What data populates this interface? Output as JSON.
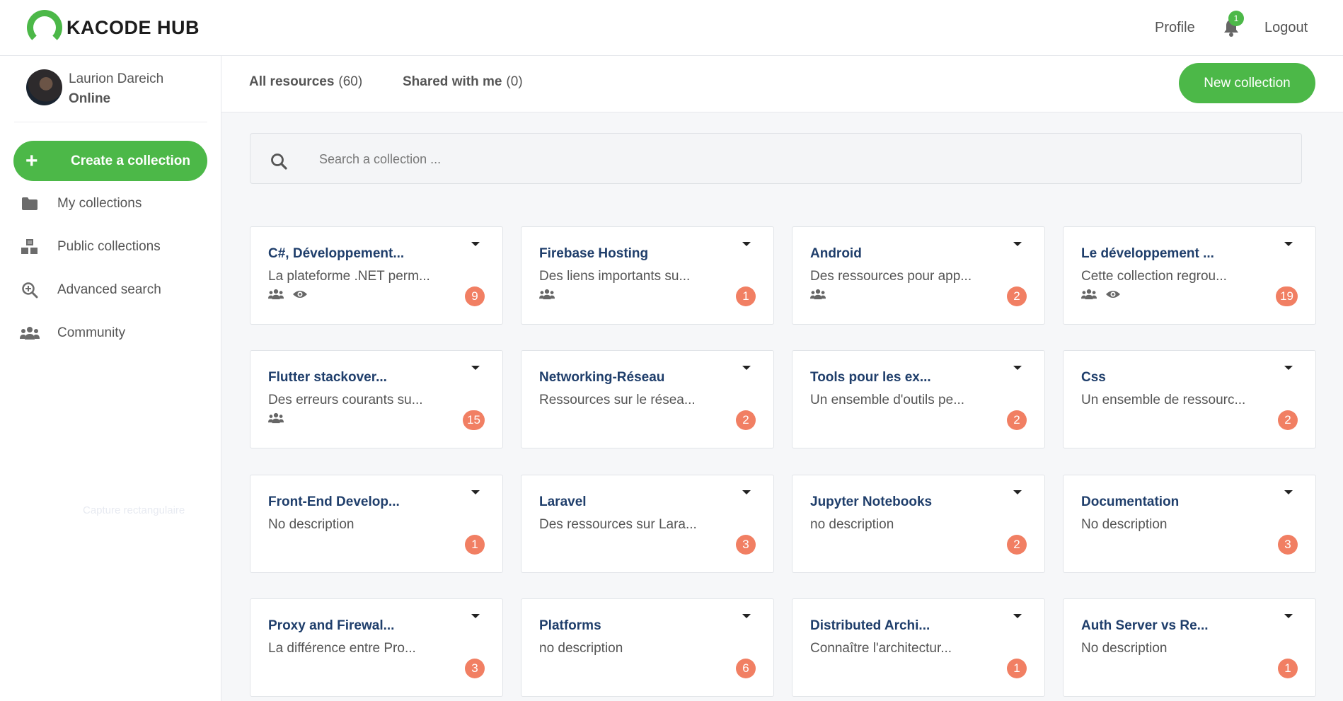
{
  "brand": {
    "logo_text": "KACODE HUB",
    "accent": "#4cb848",
    "badge_color": "#f17f63"
  },
  "topnav": {
    "profile": "Profile",
    "notifications_count": "1",
    "logout": "Logout"
  },
  "user": {
    "name": "Laurion Dareich",
    "status": "Online"
  },
  "sidebar": {
    "create_label": "Create a collection",
    "items": [
      {
        "label": "My collections",
        "icon": "folder-icon"
      },
      {
        "label": "Public collections",
        "icon": "cubes-icon"
      },
      {
        "label": "Advanced search",
        "icon": "search-plus-icon"
      },
      {
        "label": "Community",
        "icon": "users-icon"
      }
    ]
  },
  "tabs": [
    {
      "label": "All resources",
      "count": "(60)"
    },
    {
      "label": "Shared with me",
      "count": "(0)"
    }
  ],
  "new_collection_label": "New collection",
  "search": {
    "placeholder": "Search a collection ..."
  },
  "watermark": "Capture rectangulaire",
  "collections": [
    {
      "title": "C#, Développement...",
      "desc": "La plateforme .NET perm...",
      "count": "9",
      "shared": true,
      "public": true
    },
    {
      "title": "Firebase Hosting",
      "desc": "Des liens importants su...",
      "count": "1",
      "shared": true,
      "public": false
    },
    {
      "title": "Android",
      "desc": "Des ressources pour app...",
      "count": "2",
      "shared": true,
      "public": false
    },
    {
      "title": "Le développement ...",
      "desc": "Cette collection regrou...",
      "count": "19",
      "shared": true,
      "public": true
    },
    {
      "title": "Flutter stackover...",
      "desc": "Des erreurs courants su...",
      "count": "15",
      "shared": true,
      "public": false
    },
    {
      "title": "Networking-Réseau",
      "desc": "Ressources sur le résea...",
      "count": "2",
      "shared": false,
      "public": false
    },
    {
      "title": "Tools pour les ex...",
      "desc": "Un ensemble d'outils pe...",
      "count": "2",
      "shared": false,
      "public": false
    },
    {
      "title": "Css",
      "desc": "Un ensemble de ressourc...",
      "count": "2",
      "shared": false,
      "public": false
    },
    {
      "title": "Front-End Develop...",
      "desc": "No description",
      "count": "1",
      "shared": false,
      "public": false
    },
    {
      "title": "Laravel",
      "desc": "Des ressources sur Lara...",
      "count": "3",
      "shared": false,
      "public": false
    },
    {
      "title": "Jupyter Notebooks",
      "desc": "no description",
      "count": "2",
      "shared": false,
      "public": false
    },
    {
      "title": "Documentation",
      "desc": "No description",
      "count": "3",
      "shared": false,
      "public": false
    },
    {
      "title": "Proxy and Firewal...",
      "desc": "La différence entre Pro...",
      "count": "3",
      "shared": false,
      "public": false
    },
    {
      "title": "Platforms",
      "desc": "no description",
      "count": "6",
      "shared": false,
      "public": false
    },
    {
      "title": "Distributed Archi...",
      "desc": "Connaître l'architectur...",
      "count": "1",
      "shared": false,
      "public": false
    },
    {
      "title": "Auth Server vs Re...",
      "desc": "No description",
      "count": "1",
      "shared": false,
      "public": false
    }
  ]
}
